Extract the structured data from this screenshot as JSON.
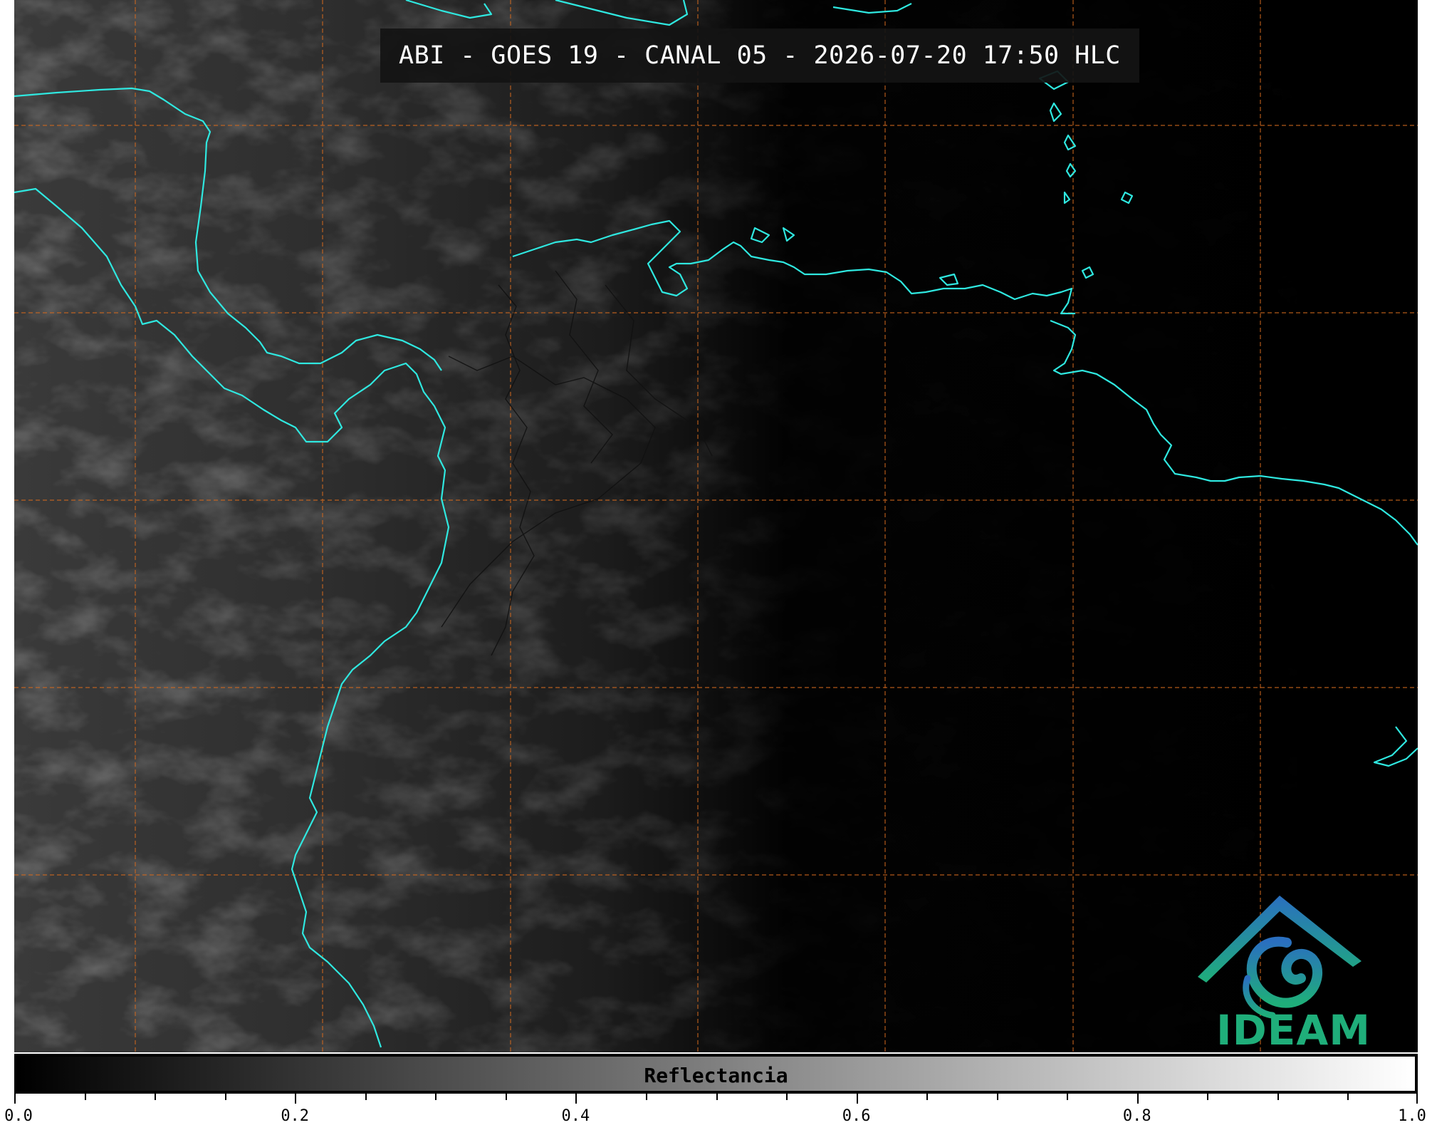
{
  "title": "ABI - GOES 19 - CANAL 05 - 2026-07-20 17:50 HLC",
  "colors": {
    "coastline": "#2fe8e0",
    "gridline": "#d2691e",
    "borders": "#111111",
    "logo_blue": "#2a6fc0",
    "logo_green": "#1fae7a"
  },
  "logo": {
    "text": "IDEAM"
  },
  "colorbar": {
    "label": "Reflectancia",
    "range": [
      0.0,
      1.0
    ],
    "colormap": "grayscale",
    "tick_labels": [
      "0.0",
      "0.2",
      "0.4",
      "0.6",
      "0.8",
      "1.0"
    ]
  }
}
